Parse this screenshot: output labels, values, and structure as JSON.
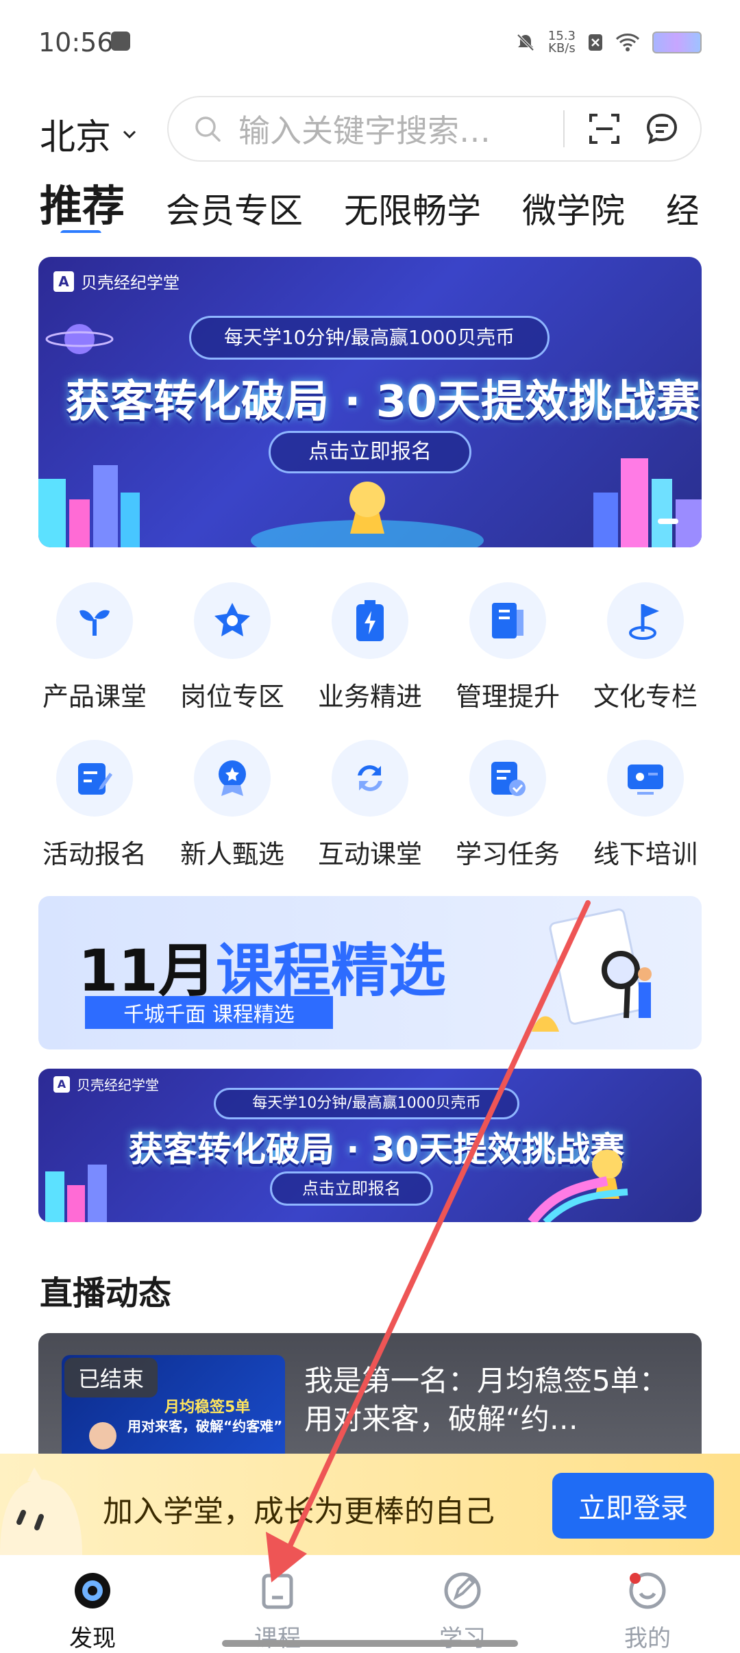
{
  "status": {
    "time": "10:56",
    "speed_value": "15.3",
    "speed_unit": "KB/s"
  },
  "header": {
    "city": "北京",
    "search_placeholder": "输入关键字搜索…"
  },
  "tabs": [
    "推荐",
    "会员专区",
    "无限畅学",
    "微学院",
    "经"
  ],
  "banner1": {
    "brand": "贝壳经纪学堂",
    "pill_top": "每天学10分钟/最高赢1000贝壳币",
    "title": "获客转化破局 · 30天提效挑战赛",
    "pill_bottom": "点击立即报名"
  },
  "grid": [
    {
      "label": "产品课堂",
      "icon": "sprout-icon"
    },
    {
      "label": "岗位专区",
      "icon": "star-icon"
    },
    {
      "label": "业务精进",
      "icon": "battery-icon"
    },
    {
      "label": "管理提升",
      "icon": "book-icon"
    },
    {
      "label": "文化专栏",
      "icon": "flag-icon"
    },
    {
      "label": "活动报名",
      "icon": "edit-icon"
    },
    {
      "label": "新人甄选",
      "icon": "badge-icon"
    },
    {
      "label": "互动课堂",
      "icon": "exchange-icon"
    },
    {
      "label": "学习任务",
      "icon": "task-icon"
    },
    {
      "label": "线下培训",
      "icon": "screen-icon"
    }
  ],
  "promo": {
    "title_black": "11月",
    "title_blue": "课程精选",
    "subtitle": "千城千面 课程精选"
  },
  "banner2": {
    "brand": "贝壳经纪学堂",
    "pill_top": "每天学10分钟/最高赢1000贝壳币",
    "title": "获客转化破局 · 30天提效挑战赛",
    "pill_bottom": "点击立即报名"
  },
  "live": {
    "section_title": "直播动态",
    "badge": "已结束",
    "title": "我是第一名：月均稳签5单：用对来客，破解“约…",
    "thumb_line1": "月均稳签5单",
    "thumb_line2": "用对来客，破解“约客难”"
  },
  "login": {
    "text": "加入学堂，成长为更棒的自己",
    "button": "立即登录"
  },
  "nav": [
    {
      "label": "发现",
      "active": true
    },
    {
      "label": "课程",
      "active": false
    },
    {
      "label": "学习",
      "active": false
    },
    {
      "label": "我的",
      "active": false
    }
  ],
  "colors": {
    "accent": "#2d7cff",
    "banner_bg": "#2c2a95",
    "login_btn": "#1f6cf5",
    "arrow": "#ee5555"
  }
}
